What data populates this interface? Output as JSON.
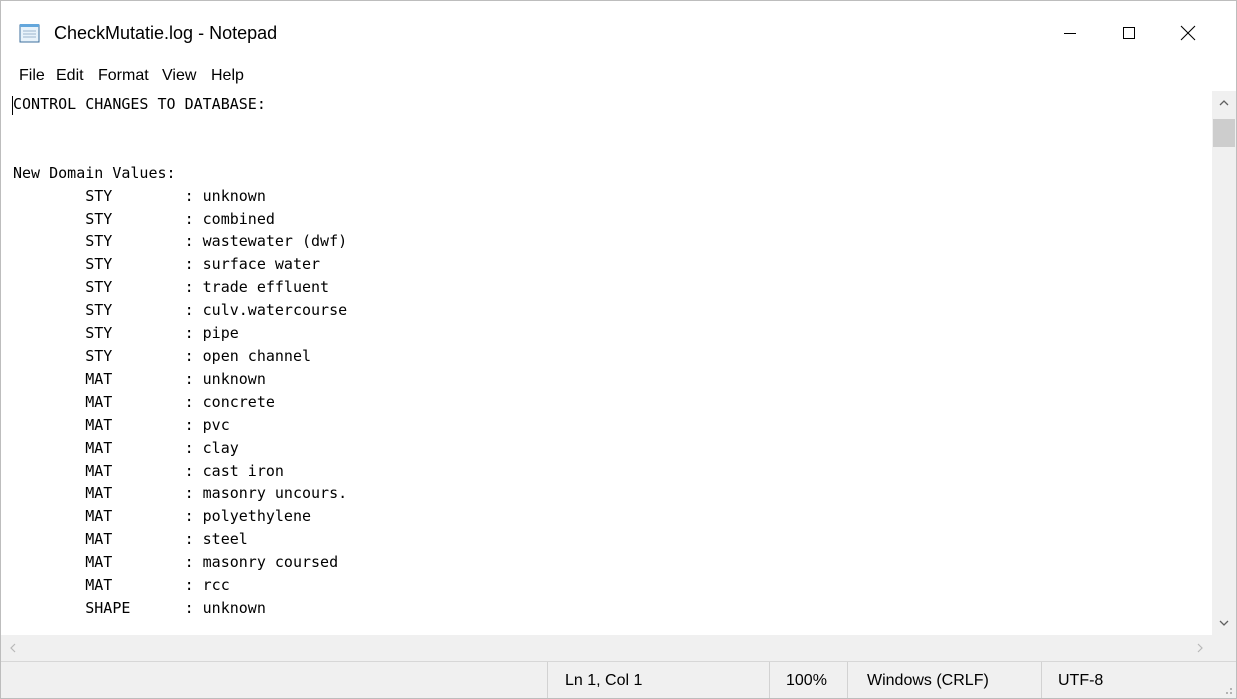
{
  "window": {
    "title": "CheckMutatie.log - Notepad",
    "icon": "notepad-icon",
    "controls": [
      "minimize-icon",
      "maximize-icon",
      "close-icon"
    ]
  },
  "menu": {
    "items": [
      "File",
      "Edit",
      "Format",
      "View",
      "Help"
    ]
  },
  "editor": {
    "lines": [
      "CONTROL CHANGES TO DATABASE:",
      "",
      "",
      "New Domain Values:",
      "        STY        : unknown",
      "        STY        : combined",
      "        STY        : wastewater (dwf)",
      "        STY        : surface water",
      "        STY        : trade effluent",
      "        STY        : culv.watercourse",
      "        STY        : pipe",
      "        STY        : open channel",
      "        MAT        : unknown",
      "        MAT        : concrete",
      "        MAT        : pvc",
      "        MAT        : clay",
      "        MAT        : cast iron",
      "        MAT        : masonry uncours.",
      "        MAT        : polyethylene",
      "        MAT        : steel",
      "        MAT        : masonry coursed",
      "        MAT        : rcc",
      "        SHAPE      : unknown"
    ]
  },
  "statusbar": {
    "position": "Ln 1, Col 1",
    "zoom": "100%",
    "line_ending": "Windows (CRLF)",
    "encoding": "UTF-8"
  },
  "colors": {
    "chrome": "#f0f0f0",
    "scroll_thumb": "#cdcdcd",
    "text": "#000000"
  }
}
